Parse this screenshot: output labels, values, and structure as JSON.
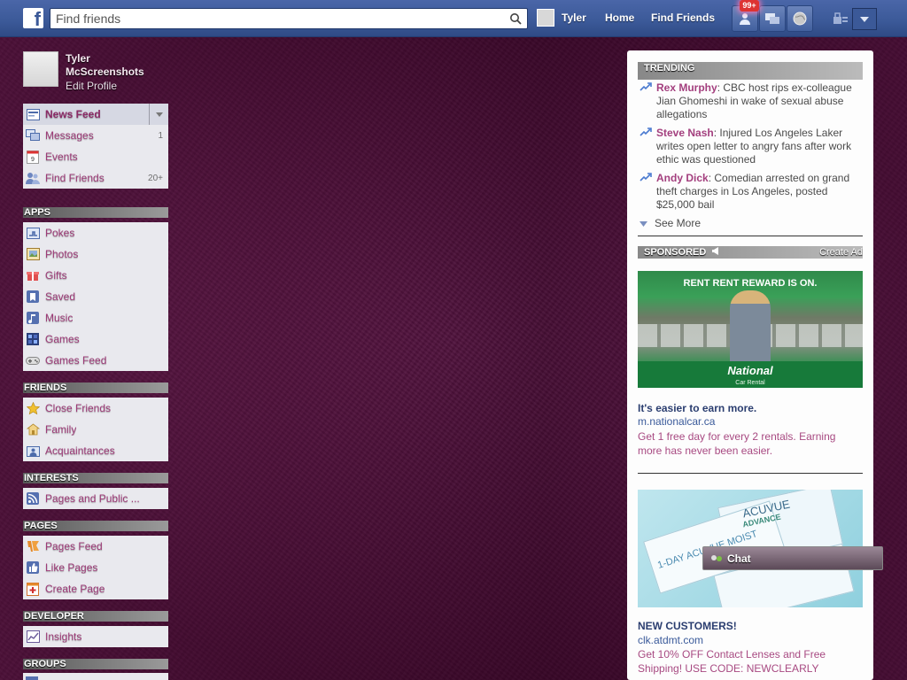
{
  "topbar": {
    "logo": "f",
    "search_placeholder": "Find friends",
    "user_name": "Tyler",
    "home": "Home",
    "find_friends": "Find Friends",
    "notif_badge": "99+"
  },
  "profile": {
    "name_line1": "Tyler",
    "name_line2": "McScreenshots",
    "edit": "Edit Profile"
  },
  "sidebar": {
    "favorites": [
      {
        "label": "News Feed",
        "icon": "news-feed-icon"
      },
      {
        "label": "Messages",
        "count": "1",
        "icon": "messages-icon"
      },
      {
        "label": "Events",
        "icon": "calendar-icon",
        "icon_text": "9"
      },
      {
        "label": "Find Friends",
        "count": "20+",
        "icon": "find-friends-icon"
      }
    ],
    "apps_head": "APPS",
    "apps": [
      {
        "label": "Pokes",
        "icon": "poke-icon"
      },
      {
        "label": "Photos",
        "icon": "photos-icon"
      },
      {
        "label": "Gifts",
        "icon": "gift-icon"
      },
      {
        "label": "Saved",
        "icon": "bookmark-icon"
      },
      {
        "label": "Music",
        "icon": "music-icon"
      },
      {
        "label": "Games",
        "icon": "games-icon"
      },
      {
        "label": "Games Feed",
        "icon": "gamepad-icon"
      }
    ],
    "friends_head": "FRIENDS",
    "friends": [
      {
        "label": "Close Friends",
        "icon": "star-icon"
      },
      {
        "label": "Family",
        "icon": "family-icon"
      },
      {
        "label": "Acquaintances",
        "icon": "acquaintances-icon"
      }
    ],
    "interests_head": "INTERESTS",
    "interests": [
      {
        "label": "Pages and Public ...",
        "icon": "rss-icon"
      }
    ],
    "pages_head": "PAGES",
    "pages": [
      {
        "label": "Pages Feed",
        "icon": "pages-feed-icon"
      },
      {
        "label": "Like Pages",
        "icon": "like-icon"
      },
      {
        "label": "Create Page",
        "icon": "create-page-icon"
      }
    ],
    "developer_head": "DEVELOPER",
    "developer": [
      {
        "label": "Insights",
        "icon": "insights-icon"
      }
    ],
    "groups_head": "GROUPS"
  },
  "trending": {
    "head": "TRENDING",
    "items": [
      {
        "who": "Rex Murphy",
        "text": ": CBC host rips ex-colleague Jian Ghomeshi in wake of sexual abuse allegations"
      },
      {
        "who": "Steve Nash",
        "text": ": Injured Los Angeles Laker writes open letter to angry fans after work ethic was questioned"
      },
      {
        "who": "Andy Dick",
        "text": ": Comedian arrested on grand theft charges in Los Angeles, posted $25,000 bail"
      }
    ],
    "see_more": "See More"
  },
  "sponsored": {
    "head": "SPONSORED",
    "create_ad": "Create Ad",
    "ads": [
      {
        "image_text": "RENT RENT REWARD IS ON.",
        "brand": "National",
        "brand_sub": "Car Rental",
        "title": "It's easier to earn more.",
        "url": "m.nationalcar.ca",
        "body": "Get 1 free day for every 2 rentals. Earning more has never been easier."
      },
      {
        "image_text_1": "ACUVUE",
        "image_text_2": "ADVANCE",
        "image_text_3": "1-DAY ACUVUE MOIST",
        "title": "NEW CUSTOMERS!",
        "url": "clk.atdmt.com",
        "body": "Get 10% OFF Contact Lenses and Free Shipping! USE CODE: NEWCLEARLY"
      }
    ]
  },
  "chat": {
    "label": "Chat"
  },
  "colors": {
    "topbar": "#3b5998",
    "link_pink": "#a33f7e",
    "background": "#5a1840"
  }
}
